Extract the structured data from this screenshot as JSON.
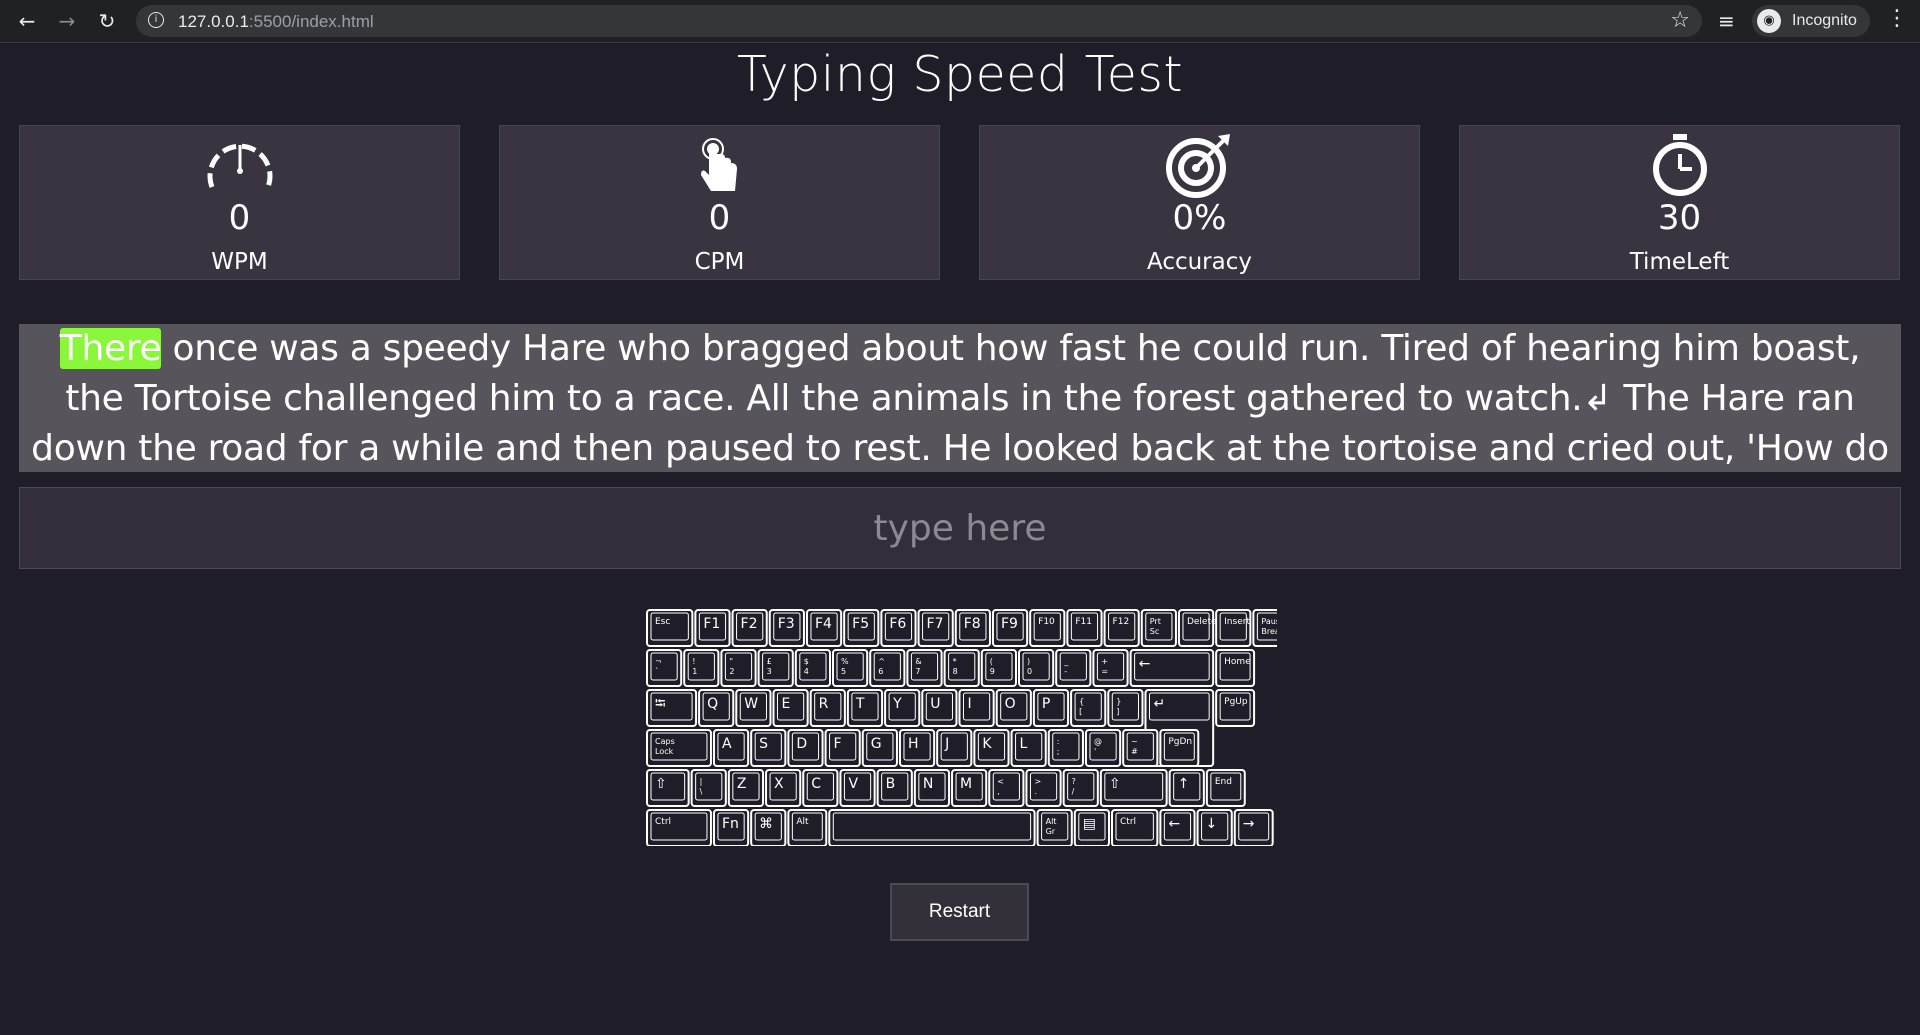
{
  "browser": {
    "url_host": "127.0.0.1",
    "url_path": ":5500/index.html",
    "incognito_label": "Incognito"
  },
  "page": {
    "title": "Typing Speed Test",
    "stats": [
      {
        "icon": "speedometer-icon",
        "value": "0",
        "label": "WPM"
      },
      {
        "icon": "pointer-hand-icon",
        "value": "0",
        "label": "CPM"
      },
      {
        "icon": "target-icon",
        "value": "0%",
        "label": "Accuracy"
      },
      {
        "icon": "stopwatch-icon",
        "value": "30",
        "label": "TimeLeft"
      }
    ],
    "passage": {
      "current_word": "There",
      "rest": " once was a speedy Hare who bragged about how fast he could run. Tired of hearing him boast, the Tortoise challenged him to a race. All the animals in the forest gathered to watch.↲ The Hare ran down the road for a while and then paused to rest. He looked back at the tortoise and cried out, 'How do you expect to win this"
    },
    "input_placeholder": "type here",
    "restart_label": "Restart",
    "colors": {
      "background": "#1f1e28",
      "stat_card": "#3a3340",
      "passage_bg": "#57555b",
      "highlight": "#8af73b"
    }
  },
  "keyboard": {
    "rows": [
      [
        "Esc",
        "F1",
        "F2",
        "F3",
        "F4",
        "F5",
        "F6",
        "F7",
        "F8",
        "F9",
        "F10",
        "F11",
        "F12",
        "Prt Sc",
        "Delete",
        "Insert",
        "Pause Break"
      ],
      [
        "¬ `",
        "! 1",
        "\" 2",
        "£ 3",
        "$ 4",
        "% 5",
        "^ 6",
        "& 7",
        "* 8",
        "( 9",
        ") 0",
        "_ -",
        "+ =",
        "←",
        "Home"
      ],
      [
        "⭾",
        "Q",
        "W",
        "E",
        "R",
        "T",
        "Y",
        "U",
        "I",
        "O",
        "P",
        "{ [",
        "} ]",
        "↵",
        "PgUp"
      ],
      [
        "Caps Lock",
        "A",
        "S",
        "D",
        "F",
        "G",
        "H",
        "J",
        "K",
        "L",
        ": ;",
        "@ '",
        "~ #",
        "PgDn"
      ],
      [
        "⇧",
        "| \\",
        "Z",
        "X",
        "C",
        "V",
        "B",
        "N",
        "M",
        "< ,",
        "> .",
        "? /",
        "⇧",
        "↑",
        "End"
      ],
      [
        "Ctrl",
        "Fn",
        "⌘",
        "Alt",
        "",
        "Alt Gr",
        "▤",
        "Ctrl",
        "←",
        "↓",
        "→"
      ]
    ]
  }
}
